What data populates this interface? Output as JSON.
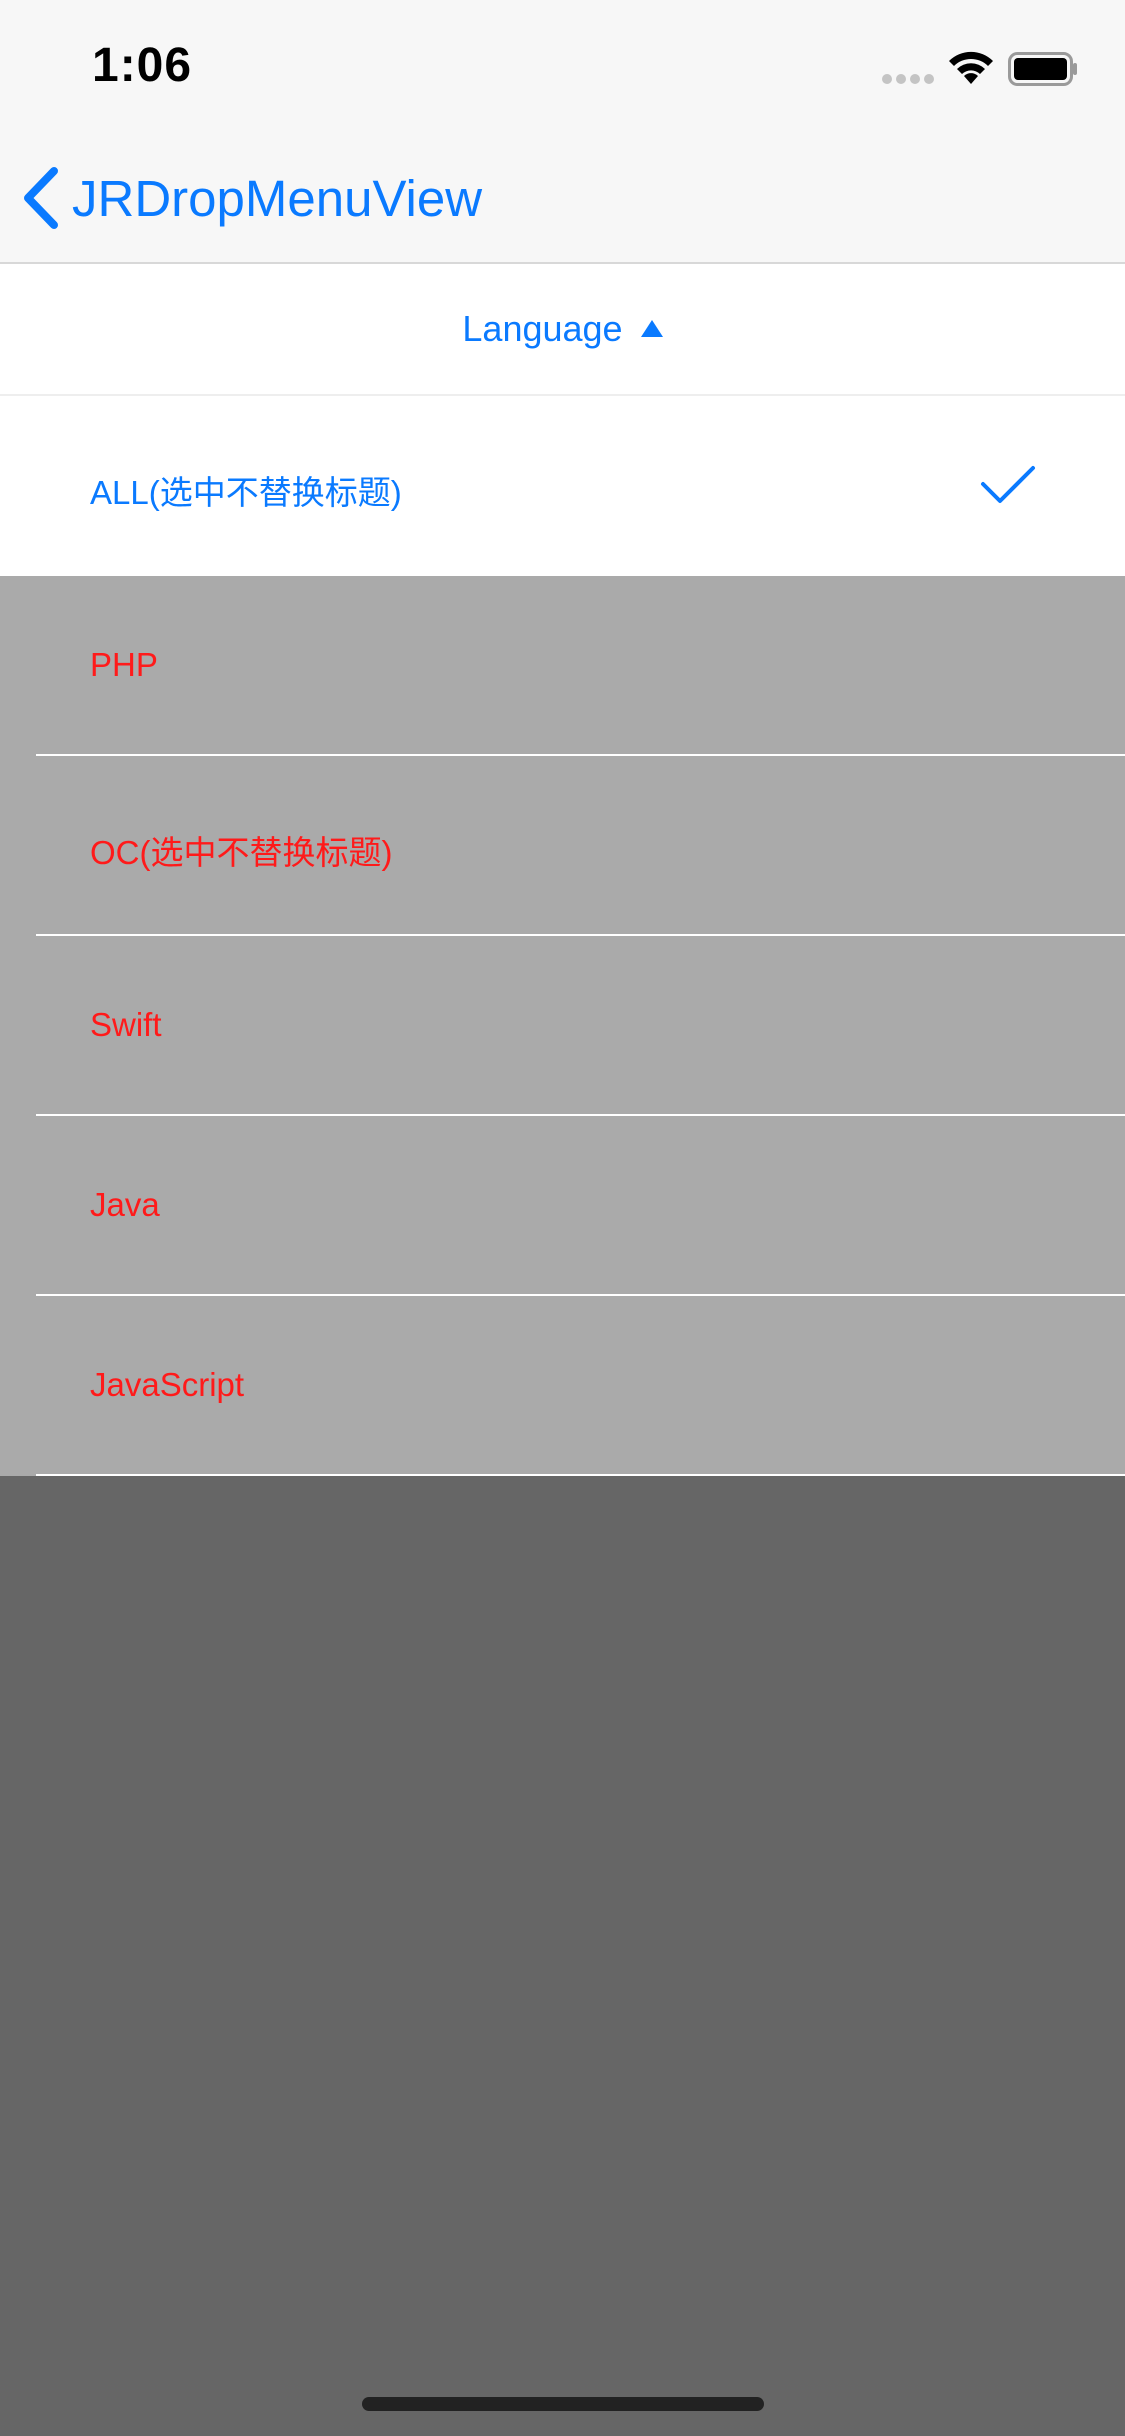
{
  "status_bar": {
    "time": "1:06"
  },
  "nav_bar": {
    "back_title": "JRDropMenuView"
  },
  "menu": {
    "header_label": "Language",
    "header_icon": "triangle-up-icon",
    "options": [
      {
        "label": "ALL(选中不替换标题)",
        "selected": true
      },
      {
        "label": "PHP",
        "selected": false
      },
      {
        "label": "OC(选中不替换标题)",
        "selected": false
      },
      {
        "label": "Swift",
        "selected": false
      },
      {
        "label": "Java",
        "selected": false
      },
      {
        "label": "JavaScript",
        "selected": false
      }
    ]
  },
  "colors": {
    "tint": "#0a7aff",
    "unselected_text": "#ff1a1a",
    "list_background": "#aaaaaa",
    "overlay": "#666666"
  }
}
